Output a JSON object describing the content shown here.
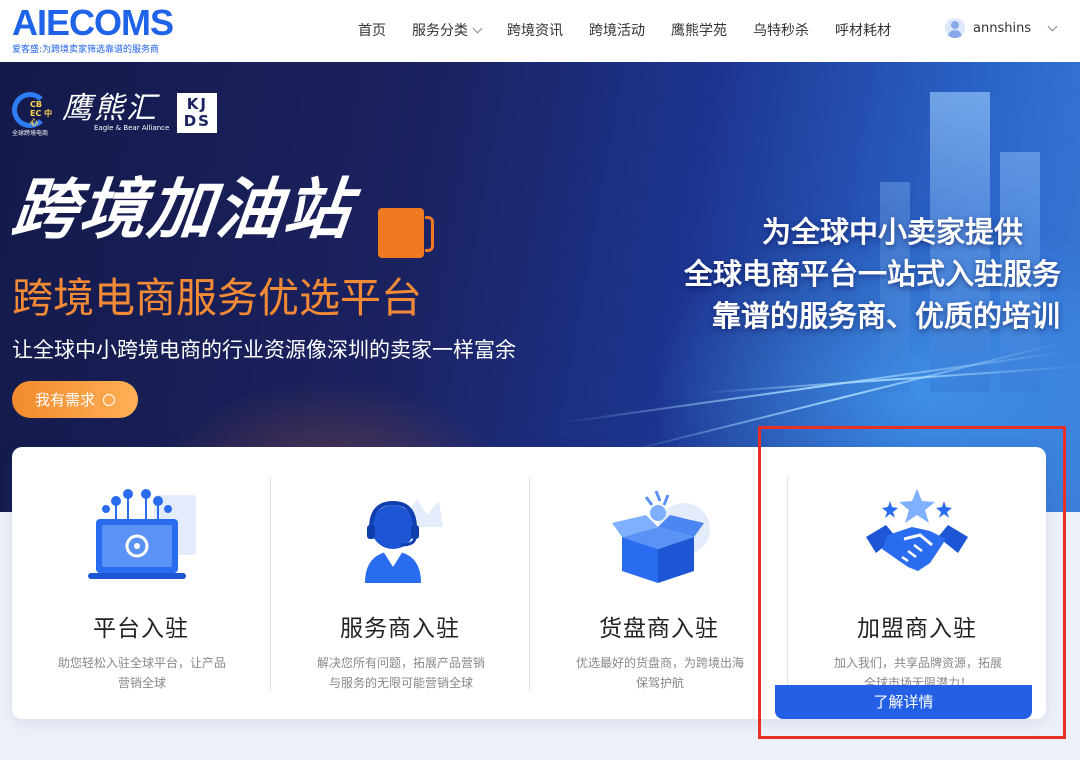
{
  "header": {
    "logo": "AIECOMS",
    "logo_sub": "爱客盛:为跨境卖家筛选靠谱的服务商",
    "nav": [
      "首页",
      "服务分类",
      "跨境资讯",
      "跨境活动",
      "鹰熊学苑",
      "乌特秒杀",
      "呼材耗材"
    ],
    "username": "annshins"
  },
  "hero": {
    "partners": {
      "cbec_text": "CB EC 中心",
      "cbec_sub": "全球跨境电商",
      "eagle_cn": "鹰熊汇",
      "eagle_en": "Eagle & Bear Alliance",
      "kjds": "KJ DS"
    },
    "headline": "跨境加油站",
    "subheadline": "跨境电商服务优选平台",
    "tagline": "让全球中小跨境电商的行业资源像深圳的卖家一样富余",
    "cta": "我有需求",
    "right_lines": [
      "为全球中小卖家提供",
      "全球电商平台一站式入驻服务",
      "靠谱的服务商、优质的培训"
    ]
  },
  "cards": [
    {
      "title": "平台入驻",
      "desc": "助您轻松入驻全球平台，让产品营销全球",
      "icon": "platform-icon"
    },
    {
      "title": "服务商入驻",
      "desc": "解决您所有问题，拓展产品营销与服务的无限可能营销全球",
      "icon": "service-agent-icon"
    },
    {
      "title": "货盘商入驻",
      "desc": "优选最好的货盘商，为跨境出海保驾护航",
      "icon": "supply-box-icon"
    },
    {
      "title": "加盟商入驻",
      "desc": "加入我们，共享品牌资源，拓展全球市场无限潜力！",
      "icon": "handshake-icon"
    }
  ],
  "detail_button": "了解详情",
  "colors": {
    "brand": "#1f63e8",
    "accent_orange": "#f28a36",
    "highlight_red": "#ea2f27"
  }
}
